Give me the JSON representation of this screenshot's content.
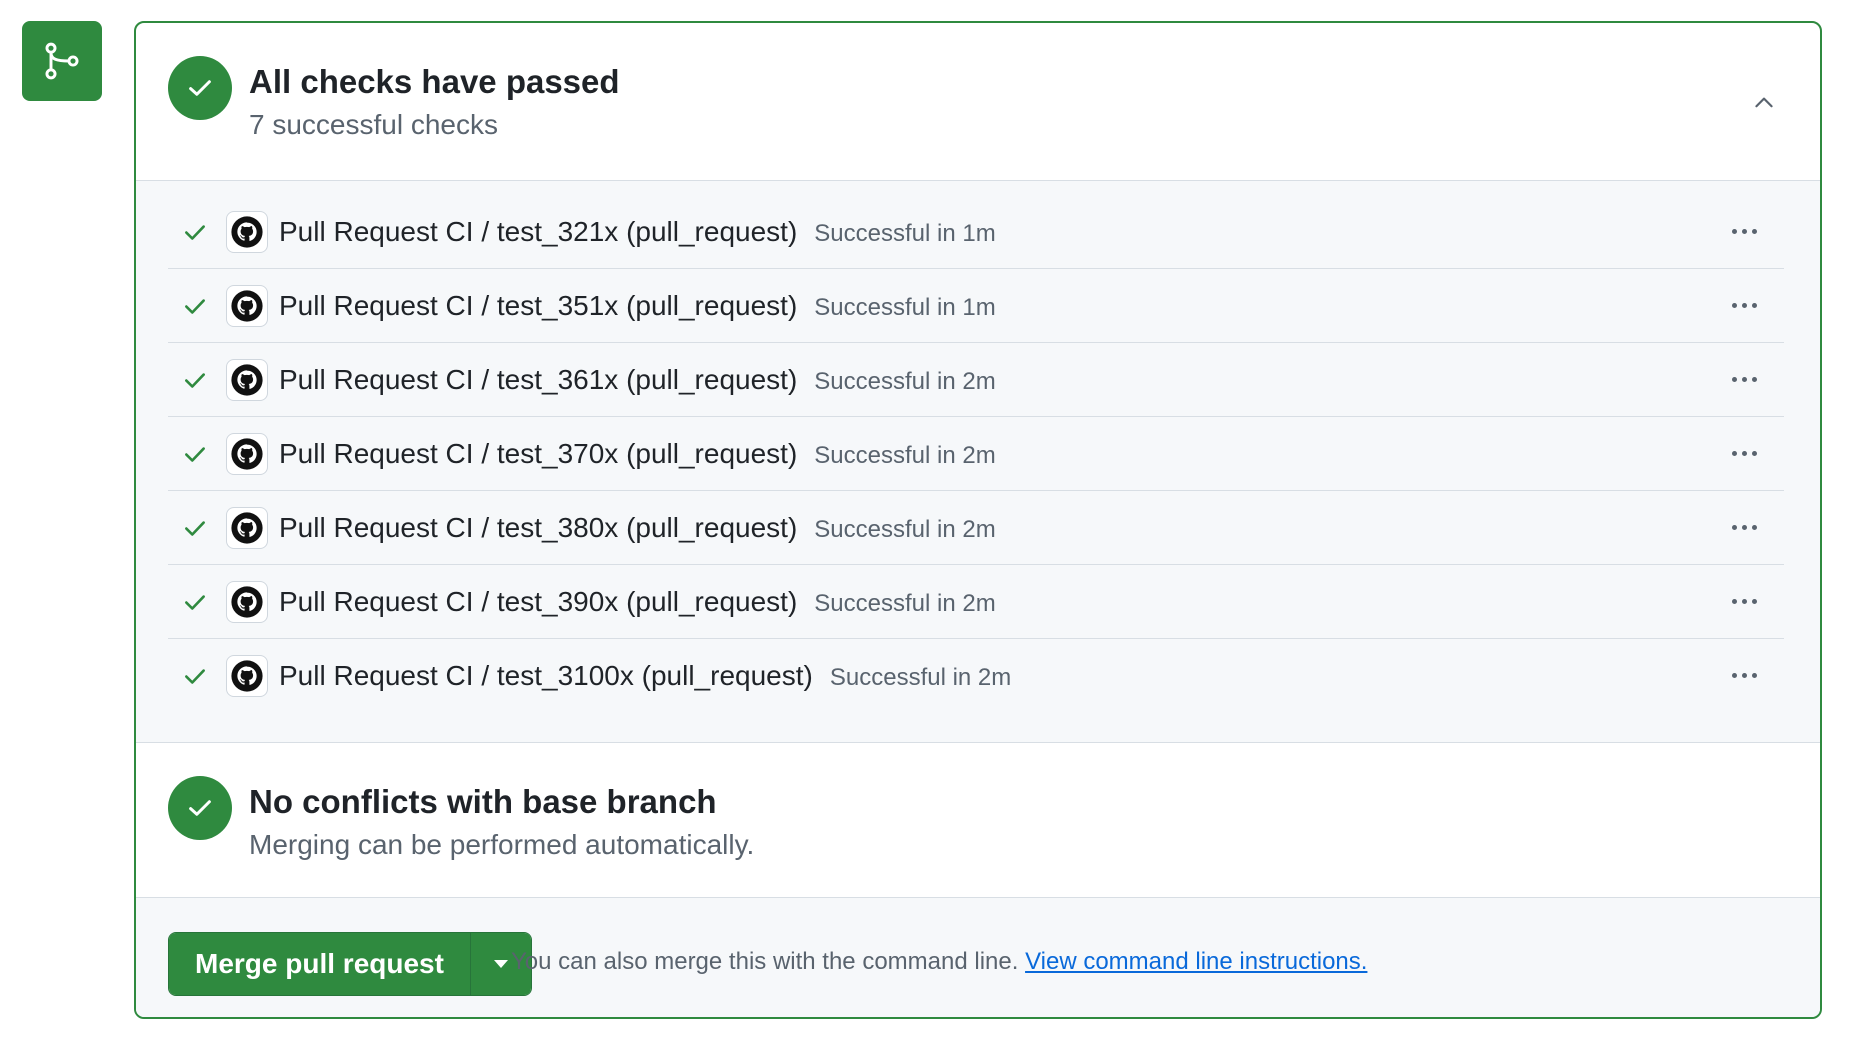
{
  "colors": {
    "success": "#2f8a3f",
    "muted": "#59636e",
    "link": "#0969da",
    "panel_bg": "#f6f8fa"
  },
  "summary": {
    "title": "All checks have passed",
    "subtitle": "7 successful checks"
  },
  "checks": [
    {
      "name": "Pull Request CI / test_321x (pull_request)",
      "status": "Successful in 1m"
    },
    {
      "name": "Pull Request CI / test_351x (pull_request)",
      "status": "Successful in 1m"
    },
    {
      "name": "Pull Request CI / test_361x (pull_request)",
      "status": "Successful in 2m"
    },
    {
      "name": "Pull Request CI / test_370x (pull_request)",
      "status": "Successful in 2m"
    },
    {
      "name": "Pull Request CI / test_380x (pull_request)",
      "status": "Successful in 2m"
    },
    {
      "name": "Pull Request CI / test_390x (pull_request)",
      "status": "Successful in 2m"
    },
    {
      "name": "Pull Request CI / test_3100x (pull_request)",
      "status": "Successful in 2m"
    }
  ],
  "conflicts": {
    "title": "No conflicts with base branch",
    "subtitle": "Merging can be performed automatically."
  },
  "merge": {
    "button_label": "Merge pull request",
    "note": "You can also merge this with the command line.",
    "link_label": "View command line instructions."
  },
  "icons": {
    "side_badge": "git-merge-icon",
    "status": "check-circle-icon",
    "row_status": "check-icon",
    "avatar": "github-logo-icon",
    "row_menu": "kebab-horizontal-icon",
    "collapse": "chevron-up-icon",
    "merge_dropdown": "triangle-down-icon"
  }
}
